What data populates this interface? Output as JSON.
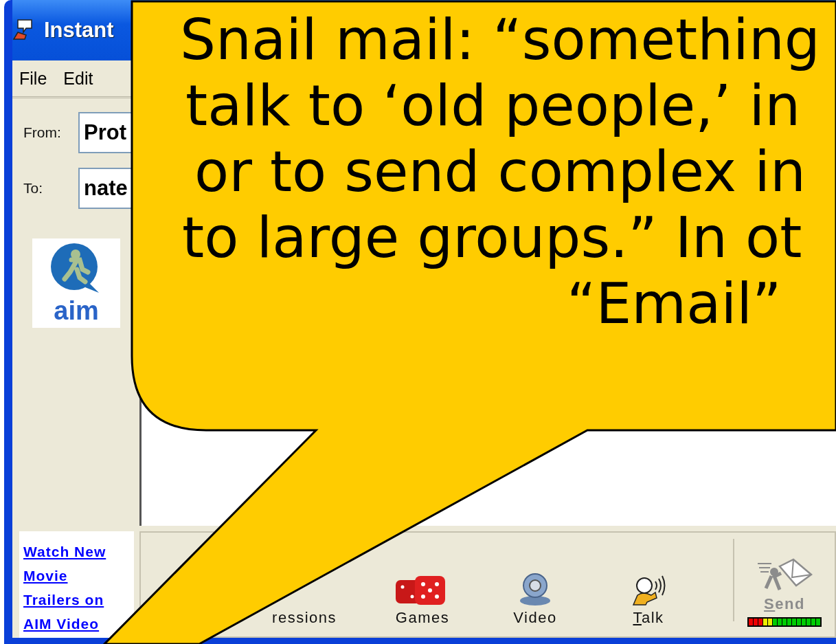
{
  "window": {
    "title": "Instant"
  },
  "menu": [
    {
      "label": "File"
    },
    {
      "label": "Edit"
    }
  ],
  "from": {
    "label": "From:",
    "value": "Prot"
  },
  "to": {
    "label": "To:",
    "value": "nate"
  },
  "logo": {
    "text": "aim"
  },
  "ad_link": {
    "lines": [
      "Watch New",
      "Movie",
      "Trailers on",
      "AIM Video"
    ]
  },
  "toolbar": [
    {
      "kind": "expressions",
      "label": "ressions",
      "access_key": false,
      "disabled": false
    },
    {
      "kind": "games",
      "label": "Games",
      "access_key": false,
      "disabled": false
    },
    {
      "kind": "video",
      "label": "Video",
      "access_key": false,
      "disabled": false
    },
    {
      "kind": "talk",
      "label": "Talk",
      "access_key": true,
      "disabled": false
    },
    {
      "kind": "send",
      "label": "Send",
      "access_key": true,
      "disabled": true
    }
  ],
  "callout": {
    "lines": [
      "Snail mail: “something",
      "talk to ‘old people,’ in",
      "or to send complex in",
      "to large groups.” In ot",
      "“Email”"
    ]
  }
}
